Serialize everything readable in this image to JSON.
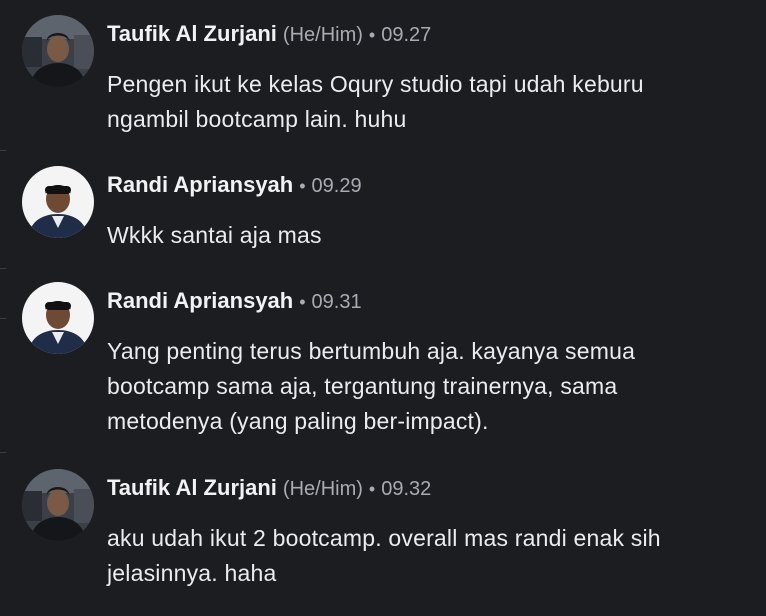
{
  "messages": [
    {
      "author": "Taufik Al Zurjani",
      "pronouns": "(He/Him)",
      "separator": "•",
      "time": "09.27",
      "lines": [
        "Pengen ikut ke kelas Oqury studio tapi udah keburu",
        "ngambil bootcamp lain. huhu"
      ]
    },
    {
      "author": "Randi Apriansyah",
      "separator": "•",
      "time": "09.29",
      "lines": [
        "Wkkk santai aja mas"
      ]
    },
    {
      "author": "Randi Apriansyah",
      "separator": "•",
      "time": "09.31",
      "lines": [
        "Yang penting terus bertumbuh aja. kayanya semua",
        "bootcamp sama aja, tergantung trainernya, sama",
        "metodenya (yang paling ber-impact)."
      ]
    },
    {
      "author": "Taufik Al Zurjani",
      "pronouns": "(He/Him)",
      "separator": "•",
      "time": "09.32",
      "lines": [
        "aku udah ikut 2 bootcamp. overall mas randi enak sih",
        "jelasinnya. haha"
      ]
    }
  ],
  "colors": {
    "background": "#1c1d21",
    "author": "#f2f2f4",
    "meta": "#a9abb2",
    "text": "#ececef"
  }
}
